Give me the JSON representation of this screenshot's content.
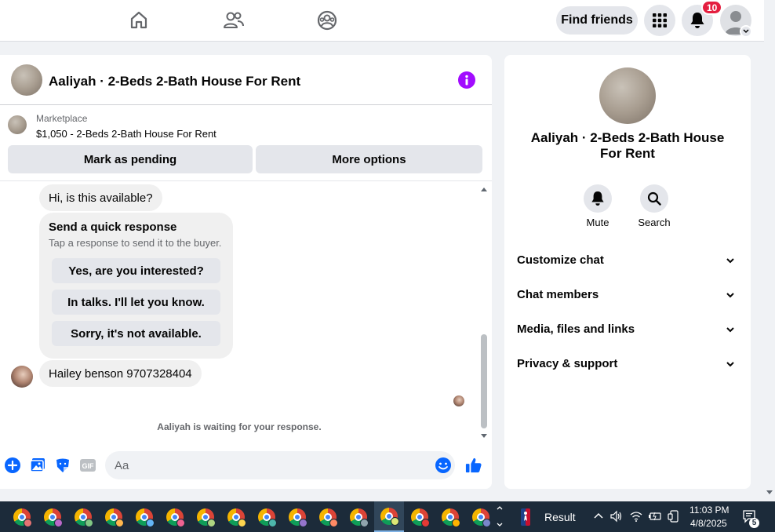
{
  "topbar": {
    "find_friends_label": "Find friends",
    "notifications_count": "10"
  },
  "chat": {
    "title": "Aaliyah · 2-Beds 2-Bath House For Rent",
    "marketplace_label": "Marketplace",
    "listing": "$1,050 - 2-Beds 2-Bath House For Rent",
    "mark_pending_label": "Mark as pending",
    "more_options_label": "More options",
    "messages": {
      "buyer_message": "Hi, is this available?",
      "quick_title": "Send a quick response",
      "quick_subtitle": "Tap a response to send it to the buyer.",
      "quick_replies": [
        "Yes, are you interested?",
        "In talks. I'll let you know.",
        "Sorry, it's not available."
      ],
      "seller_message": "Hailey benson 9707328404"
    },
    "waiting_text": "Aaliyah is waiting for your response.",
    "composer_placeholder": "Aa"
  },
  "side": {
    "name": "Aaliyah · 2-Beds 2-Bath House For Rent",
    "mute_label": "Mute",
    "search_label": "Search",
    "rows": [
      "Customize chat",
      "Chat members",
      "Media, files and links",
      "Privacy & support"
    ]
  },
  "taskbar": {
    "weather_label": "Result",
    "time": "11:03 PM",
    "date": "4/8/2025",
    "chat_count": "5",
    "profile_colors": [
      "#e57373",
      "#ba68c8",
      "#81c784",
      "#ffb74d",
      "#64b5f6",
      "#f06292",
      "#aed581",
      "#ffd54f",
      "#4db6ac",
      "#9575cd",
      "#ff8a65",
      "#90a4ae",
      "#dce775",
      "#e53935",
      "#ffb300",
      "#7986cb"
    ],
    "icons": [
      "chrome-icon",
      "nba-icon",
      "chevron-up-icon",
      "speaker-icon",
      "wifi-icon",
      "battery-icon",
      "phone-link-icon",
      "notification-icon"
    ]
  }
}
